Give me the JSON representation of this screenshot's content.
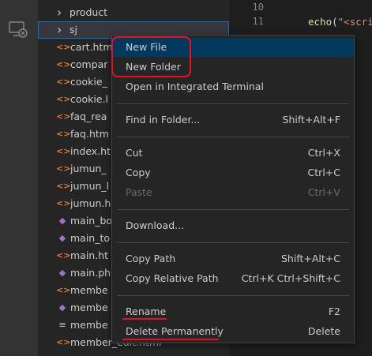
{
  "explorer": {
    "items": [
      {
        "type": "folder",
        "label": "product",
        "icon": "chevron-right-icon"
      },
      {
        "type": "folder",
        "label": "sj",
        "icon": "chevron-right-icon",
        "selected": true
      },
      {
        "type": "html",
        "label": "cart.htm",
        "icon": "html-file-icon"
      },
      {
        "type": "html",
        "label": "compar",
        "icon": "html-file-icon"
      },
      {
        "type": "html",
        "label": "cookie_",
        "icon": "html-file-icon"
      },
      {
        "type": "html",
        "label": "cookie.l",
        "icon": "html-file-icon"
      },
      {
        "type": "html",
        "label": "faq_rea",
        "icon": "html-file-icon"
      },
      {
        "type": "html",
        "label": "faq.htm",
        "icon": "html-file-icon"
      },
      {
        "type": "html",
        "label": "index.ht",
        "icon": "html-file-icon"
      },
      {
        "type": "html",
        "label": "jumun_",
        "icon": "html-file-icon"
      },
      {
        "type": "html",
        "label": "jumun_l",
        "icon": "html-file-icon"
      },
      {
        "type": "html",
        "label": "jumun.h",
        "icon": "html-file-icon"
      },
      {
        "type": "php",
        "label": "main_bo",
        "icon": "php-file-icon"
      },
      {
        "type": "php",
        "label": "main_to",
        "icon": "php-file-icon"
      },
      {
        "type": "html",
        "label": "main.ht",
        "icon": "html-file-icon"
      },
      {
        "type": "php",
        "label": "main.ph",
        "icon": "php-file-icon"
      },
      {
        "type": "html",
        "label": "membe",
        "icon": "html-file-icon"
      },
      {
        "type": "php",
        "label": "membe",
        "icon": "php-file-icon"
      },
      {
        "type": "txt",
        "label": "membe",
        "icon": "text-file-icon"
      },
      {
        "type": "html",
        "label": "member_edit.html",
        "icon": "html-file-icon"
      }
    ]
  },
  "editor": {
    "lines": [
      {
        "num": "10",
        "code": ""
      },
      {
        "num": "11",
        "fn": "echo",
        "punct": "(",
        "str": "\"<scri"
      }
    ]
  },
  "context_menu": {
    "items": [
      {
        "label": "New File",
        "shortcut": "",
        "active": true
      },
      {
        "label": "New Folder",
        "shortcut": ""
      },
      {
        "label": "Open in Integrated Terminal",
        "shortcut": ""
      },
      {
        "separator": true
      },
      {
        "label": "Find in Folder...",
        "shortcut": "Shift+Alt+F"
      },
      {
        "separator": true
      },
      {
        "label": "Cut",
        "shortcut": "Ctrl+X"
      },
      {
        "label": "Copy",
        "shortcut": "Ctrl+C"
      },
      {
        "label": "Paste",
        "shortcut": "Ctrl+V",
        "disabled": true
      },
      {
        "separator": true
      },
      {
        "label": "Download...",
        "shortcut": ""
      },
      {
        "separator": true
      },
      {
        "label": "Copy Path",
        "shortcut": "Shift+Alt+C"
      },
      {
        "label": "Copy Relative Path",
        "shortcut": "Ctrl+K Ctrl+Shift+C"
      },
      {
        "separator": true
      },
      {
        "label": "Rename",
        "shortcut": "F2"
      },
      {
        "label": "Delete Permanently",
        "shortcut": "Delete"
      }
    ]
  },
  "colors": {
    "annotation": "#e81123",
    "menu_active": "#04395e",
    "html_icon": "#e37933",
    "php_icon": "#a074c4"
  }
}
